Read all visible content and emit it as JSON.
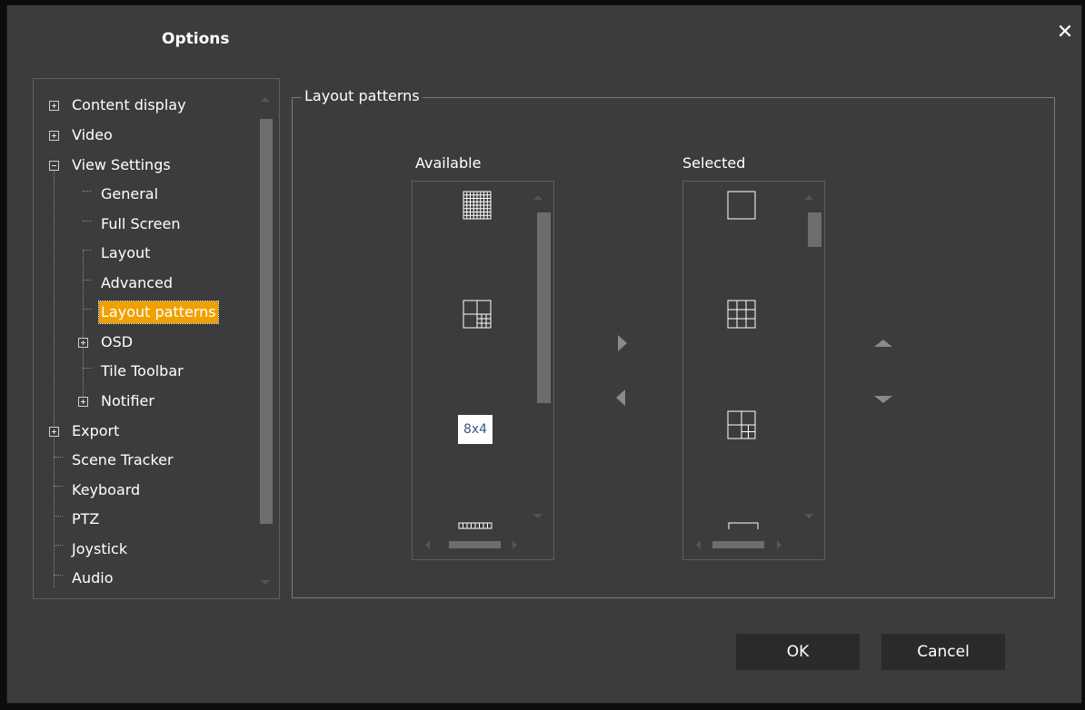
{
  "dialog": {
    "title": "Options",
    "close_glyph": "✕"
  },
  "tree": {
    "items": [
      {
        "label": "Content display",
        "expander": "plus"
      },
      {
        "label": "Video",
        "expander": "plus"
      },
      {
        "label": "View Settings",
        "expander": "minus"
      },
      {
        "label": "General"
      },
      {
        "label": "Full Screen"
      },
      {
        "label": "Layout"
      },
      {
        "label": "Advanced"
      },
      {
        "label": "Layout patterns",
        "selected": true
      },
      {
        "label": "OSD",
        "expander": "plus"
      },
      {
        "label": "Tile Toolbar"
      },
      {
        "label": "Notifier",
        "expander": "plus"
      },
      {
        "label": "Export",
        "expander": "plus"
      },
      {
        "label": "Scene Tracker"
      },
      {
        "label": "Keyboard"
      },
      {
        "label": "PTZ"
      },
      {
        "label": "Joystick"
      },
      {
        "label": "Audio"
      }
    ]
  },
  "panel": {
    "group_title": "Layout patterns",
    "available_label": "Available",
    "selected_label": "Selected",
    "available_items": [
      "8x8 grid",
      "2x2 with 3x3 corner",
      "8x4",
      "8x1 strip"
    ],
    "available_item_text": {
      "8x4": "8x4"
    },
    "selected_items": [
      "1x1",
      "3x3 grid",
      "2x2 with 2x2 corner",
      "1x1 partial"
    ]
  },
  "buttons": {
    "ok": "OK",
    "cancel": "Cancel"
  },
  "colors": {
    "selection": "#f0a000",
    "background": "#3c3c3c",
    "button": "#2a2a2a"
  }
}
